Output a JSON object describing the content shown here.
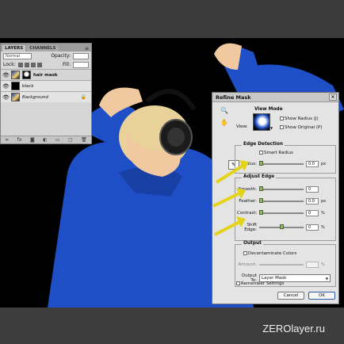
{
  "layers_panel": {
    "tabs": [
      {
        "label": "LAYERS",
        "active": true
      },
      {
        "label": "CHANNELS",
        "active": false
      }
    ],
    "blend_mode": "Normal",
    "opacity_label": "Opacity:",
    "lock_label": "Lock:",
    "fill_label": "Fill:",
    "layers": [
      {
        "name": "hair mask",
        "selected": true,
        "style": "bold",
        "thumb": "image+mask"
      },
      {
        "name": "black",
        "selected": false,
        "style": "normal",
        "thumb": "black"
      },
      {
        "name": "Background",
        "selected": false,
        "style": "italic",
        "thumb": "image",
        "locked": true
      }
    ]
  },
  "refine_mask": {
    "title": "Refine Mask",
    "view_mode": {
      "title": "View Mode",
      "view_label": "View:",
      "show_radius": "Show Radius (J)",
      "show_original": "Show Original (P)"
    },
    "edge_detection": {
      "title": "Edge Detection",
      "smart_radius": "Smart Radius",
      "radius_label": "Radius:",
      "radius_value": "0.0",
      "radius_unit": "px"
    },
    "adjust_edge": {
      "title": "Adjust Edge",
      "smooth_label": "Smooth:",
      "smooth_value": "0",
      "feather_label": "Feather:",
      "feather_value": "0.0",
      "feather_unit": "px",
      "contrast_label": "Contrast:",
      "contrast_value": "0",
      "contrast_unit": "%",
      "shift_label": "Shift Edge:",
      "shift_value": "0",
      "shift_unit": "%"
    },
    "output": {
      "title": "Output",
      "decontaminate": "Decontaminate Colors",
      "amount_label": "Amount:",
      "amount_unit": "%",
      "output_to_label": "Output To:",
      "output_to_value": "Layer Mask"
    },
    "remember_settings": "Remember Settings",
    "cancel_label": "Cancel",
    "ok_label": "OK"
  },
  "watermark": "ZEROlayer.ru",
  "colors": {
    "arrow": "#e3d31a",
    "jacket": "#1f4fc7"
  }
}
